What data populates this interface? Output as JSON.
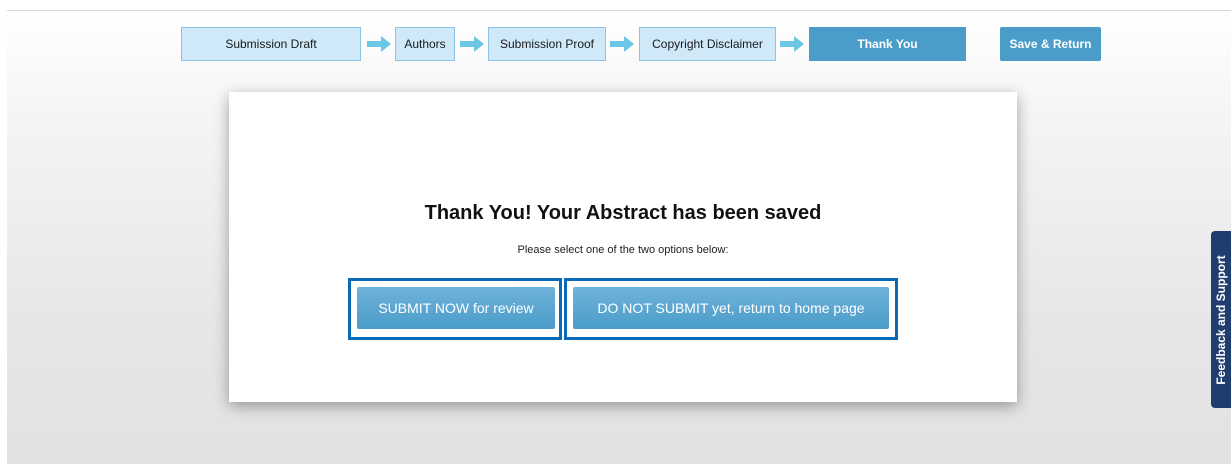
{
  "steps": [
    {
      "label": "Submission Draft"
    },
    {
      "label": "Authors"
    },
    {
      "label": "Submission Proof"
    },
    {
      "label": "Copyright Disclaimer"
    },
    {
      "label": "Thank You"
    }
  ],
  "save_return_label": "Save & Return",
  "card": {
    "title": "Thank You! Your Abstract has been saved",
    "subtitle": "Please select one of the two options below:",
    "submit_now_label": "SUBMIT NOW for review",
    "do_not_submit_label": "DO NOT SUBMIT yet, return to home page"
  },
  "feedback_label": "Feedback and Support",
  "colors": {
    "step_bg": "#cfe9f8",
    "active_step": "#4a9cc9",
    "arrow": "#6cc6e6",
    "highlight_frame": "#0a6ab8",
    "feedback_tab": "#1f3d6e"
  },
  "icons": {
    "arrow": "arrow-right-icon"
  }
}
